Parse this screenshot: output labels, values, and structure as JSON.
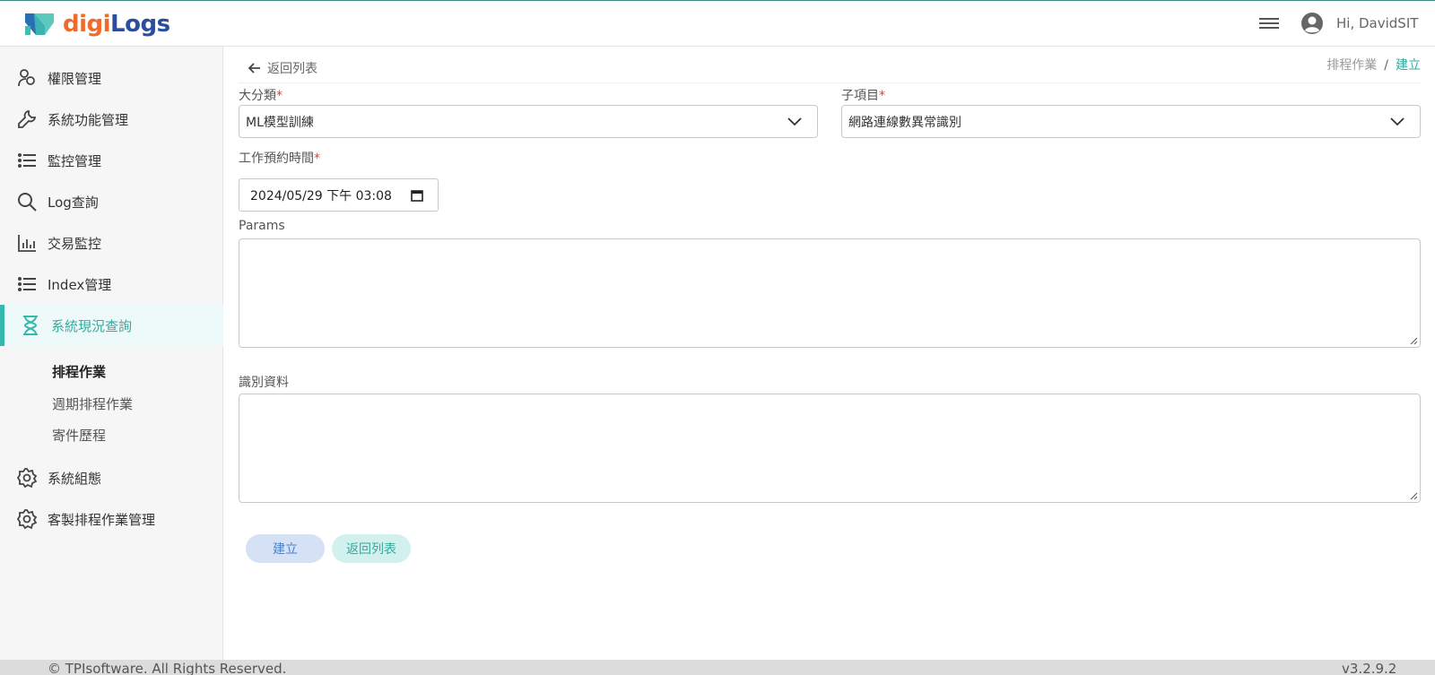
{
  "header": {
    "logo_part1": "digi",
    "logo_part2": "Logs",
    "user_greeting": "Hi, DavidSIT"
  },
  "sidebar": {
    "items": [
      {
        "label": "權限管理",
        "icon": "users-icon"
      },
      {
        "label": "系統功能管理",
        "icon": "wrench-icon"
      },
      {
        "label": "監控管理",
        "icon": "list-icon"
      },
      {
        "label": "Log查詢",
        "icon": "search-icon"
      },
      {
        "label": "交易監控",
        "icon": "bar-chart-icon"
      },
      {
        "label": "Index管理",
        "icon": "list-icon"
      },
      {
        "label": "系統現況查詢",
        "icon": "hourglass-icon"
      },
      {
        "label": "系統組態",
        "icon": "gear-icon"
      },
      {
        "label": "客製排程作業管理",
        "icon": "gear-icon"
      }
    ],
    "sub_items": [
      {
        "label": "排程作業"
      },
      {
        "label": "週期排程作業"
      },
      {
        "label": "寄件歷程"
      }
    ]
  },
  "page": {
    "back_link": "返回列表",
    "breadcrumb": {
      "parent": "排程作業",
      "separator": "/",
      "current": "建立"
    }
  },
  "form": {
    "category_label": "大分類",
    "category_value": "ML模型訓練",
    "subitem_label": "子項目",
    "subitem_value": "網路連線數異常識別",
    "schedule_label": "工作預約時間",
    "schedule_value": "2024/05/29 下午 03:08",
    "required_mark": "*",
    "params_label": "Params",
    "params_value": "",
    "ident_label": "識別資料",
    "ident_value": "",
    "create_button": "建立",
    "back_button": "返回列表"
  },
  "footer": {
    "copyright": "© TPIsoftware. All Rights Reserved.",
    "version": "v3.2.9.2"
  },
  "colors": {
    "accent": "#35b9ad",
    "brand_orange": "#f06a2a",
    "brand_blue": "#2a4d9c",
    "required": "#e04040",
    "create_button_bg": "#d5e2f6",
    "back_button_bg": "#d2f1ee"
  }
}
